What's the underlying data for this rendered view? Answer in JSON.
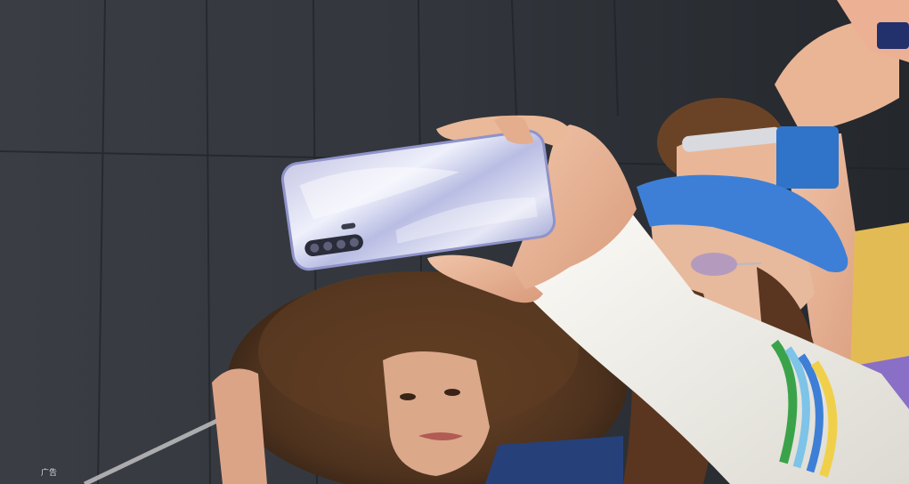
{
  "ad_label": "广告",
  "colors": {
    "wall": "#2f3339",
    "phone": "#dfe0f2",
    "beret": "#3d7fd6",
    "wristband": "#2f74c9",
    "sleeve": "#f1f0ec",
    "hair": "#5b3a22"
  }
}
